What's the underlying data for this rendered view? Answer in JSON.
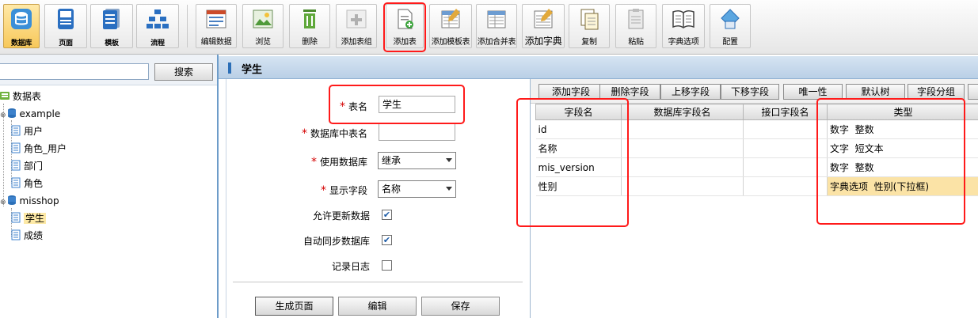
{
  "toolbar": {
    "nav": [
      {
        "label": "数据库",
        "icon": "database-icon"
      },
      {
        "label": "页面",
        "icon": "page-icon"
      },
      {
        "label": "模板",
        "icon": "template-icon"
      },
      {
        "label": "流程",
        "icon": "flow-icon"
      }
    ],
    "actions": [
      {
        "label": "编辑数据",
        "icon": "edit-data-icon"
      },
      {
        "label": "浏览",
        "icon": "browse-icon"
      },
      {
        "label": "删除",
        "icon": "trash-icon"
      },
      {
        "label": "添加表组",
        "icon": "add-table-group-icon"
      },
      {
        "label": "添加表",
        "icon": "add-table-icon"
      },
      {
        "label": "添加模板表",
        "icon": "add-template-table-icon"
      },
      {
        "label": "添加合并表",
        "icon": "add-merge-table-icon"
      },
      {
        "label": "添加字典",
        "icon": "add-dictionary-icon"
      },
      {
        "label": "复制",
        "icon": "copy-icon"
      },
      {
        "label": "粘贴",
        "icon": "paste-icon"
      },
      {
        "label": "字典选项",
        "icon": "dictionary-options-icon"
      },
      {
        "label": "配置",
        "icon": "config-icon"
      }
    ]
  },
  "sidebar": {
    "search_button": "搜索",
    "search_value": "",
    "tree": [
      {
        "label": "数据表"
      },
      {
        "label": "example"
      },
      {
        "label": "用户"
      },
      {
        "label": "角色_用户"
      },
      {
        "label": "部门"
      },
      {
        "label": "角色"
      },
      {
        "label": "misshop"
      },
      {
        "label": "学生"
      },
      {
        "label": "成绩"
      }
    ]
  },
  "form": {
    "header_title": "学生",
    "fields": {
      "table_name": {
        "label": "表名",
        "value": "学生"
      },
      "db_table_name": {
        "label": "数据库中表名",
        "value": ""
      },
      "use_database": {
        "label": "使用数据库",
        "value": "继承"
      },
      "display_field": {
        "label": "显示字段",
        "value": "名称"
      },
      "allow_update": {
        "label": "允许更新数据",
        "checked": true
      },
      "auto_sync": {
        "label": "自动同步数据库",
        "checked": true
      },
      "log": {
        "label": "记录日志",
        "checked": false
      }
    },
    "buttons": {
      "generate": "生成页面",
      "edit": "编辑",
      "save": "保存"
    }
  },
  "grid": {
    "toolbar": [
      "添加字段",
      "删除字段",
      "上移字段",
      "下移字段",
      "唯一性",
      "默认树",
      "字段分组"
    ],
    "columns": [
      "字段名",
      "数据库字段名",
      "接口字段名",
      "类型"
    ],
    "rows": [
      {
        "name": "id",
        "db": "",
        "api": "",
        "type_a": "数字",
        "type_b": "整数"
      },
      {
        "name": "名称",
        "db": "",
        "api": "",
        "type_a": "文字",
        "type_b": "短文本"
      },
      {
        "name": "mis_version",
        "db": "",
        "api": "",
        "type_a": "数字",
        "type_b": "整数"
      },
      {
        "name": "性别",
        "db": "",
        "api": "",
        "type_a": "字典选项",
        "type_b": "性别(下拉框)"
      }
    ]
  },
  "colors": {
    "highlight": "#fbe3a6",
    "annotation": "#ff1a1a",
    "header": "#b9cfe6",
    "required": "#d40000"
  }
}
